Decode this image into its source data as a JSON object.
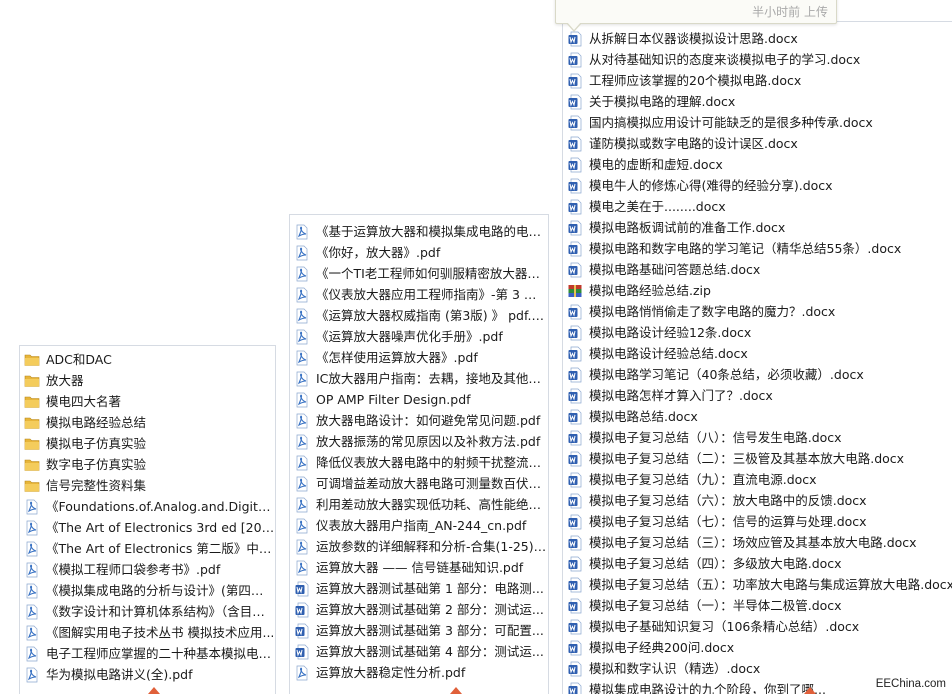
{
  "tooltip": {
    "text": "半小时前 上传"
  },
  "watermark": {
    "text": "EEChina.com"
  },
  "colors": {
    "folder": "#e7b53a",
    "pdf": "#3a73c4",
    "docx": "#2f5fb0",
    "zip": "#c0392b",
    "marker": "#e0603a"
  },
  "panel1": {
    "items": [
      {
        "icon": "folder-icon",
        "label": "ADC和DAC"
      },
      {
        "icon": "folder-icon",
        "label": "放大器"
      },
      {
        "icon": "folder-icon",
        "label": "模电四大名著"
      },
      {
        "icon": "folder-icon",
        "label": "模拟电路经验总结"
      },
      {
        "icon": "folder-icon",
        "label": "模拟电子仿真实验"
      },
      {
        "icon": "folder-icon",
        "label": "数字电子仿真实验"
      },
      {
        "icon": "folder-icon",
        "label": "信号完整性资料集"
      },
      {
        "icon": "pdf-icon",
        "label": "《Foundations.of.Analog.and.Digital.E..."
      },
      {
        "icon": "pdf-icon",
        "label": "《The Art of Electronics 3rd ed [2015..."
      },
      {
        "icon": "pdf-icon",
        "label": "《The Art of Electronics 第二版》中文..."
      },
      {
        "icon": "pdf-icon",
        "label": "《模拟工程师口袋参考书》.pdf"
      },
      {
        "icon": "pdf-icon",
        "label": "《模拟集成电路的分析与设计》(第四版..."
      },
      {
        "icon": "pdf-icon",
        "label": "《数字设计和计算机体系结构》（含目录..."
      },
      {
        "icon": "pdf-icon",
        "label": "《图解实用电子技术丛书 模拟技术应用..."
      },
      {
        "icon": "pdf-icon",
        "label": "电子工程师应掌握的二十种基本模拟电路..."
      },
      {
        "icon": "pdf-icon",
        "label": "华为模拟电路讲义(全).pdf"
      }
    ]
  },
  "panel2": {
    "items": [
      {
        "icon": "pdf-icon",
        "label": "《基于运算放大器和模拟集成电路的电路..."
      },
      {
        "icon": "pdf-icon",
        "label": "《你好，放大器》.pdf"
      },
      {
        "icon": "pdf-icon",
        "label": "《一个TI老工程师如何驯服精密放大器》..."
      },
      {
        "icon": "pdf-icon",
        "label": "《仪表放大器应用工程师指南》-第 3 版..."
      },
      {
        "icon": "pdf-icon",
        "label": "《运算放大器权威指南 (第3版) 》 pdf.pdf"
      },
      {
        "icon": "pdf-icon",
        "label": "《运算放大器噪声优化手册》.pdf"
      },
      {
        "icon": "pdf-icon",
        "label": "《怎样使用运算放大器》.pdf"
      },
      {
        "icon": "pdf-icon",
        "label": "IC放大器用户指南：去耦，接地及其他一..."
      },
      {
        "icon": "pdf-icon",
        "label": "OP AMP Filter Design.pdf"
      },
      {
        "icon": "pdf-icon",
        "label": "放大器电路设计：如何避免常见问题.pdf"
      },
      {
        "icon": "pdf-icon",
        "label": "放大器振荡的常见原因以及补救方法.pdf"
      },
      {
        "icon": "pdf-icon",
        "label": "降低仪表放大器电路中的射频干扰整流误..."
      },
      {
        "icon": "pdf-icon",
        "label": "可调增益差动放大器电路可测量数百伏电..."
      },
      {
        "icon": "pdf-icon",
        "label": "利用差动放大器实现低功耗、高性能绝对..."
      },
      {
        "icon": "pdf-icon",
        "label": "仪表放大器用户指南_AN-244_cn.pdf"
      },
      {
        "icon": "pdf-icon",
        "label": "运放参数的详细解释和分析-合集(1-25)...."
      },
      {
        "icon": "pdf-icon",
        "label": "运算放大器 —— 信号链基础知识.pdf"
      },
      {
        "icon": "docx-icon",
        "label": "运算放大器测试基础第 1 部分：电路测..."
      },
      {
        "icon": "docx-icon",
        "label": "运算放大器测试基础第 2 部分：测试运..."
      },
      {
        "icon": "docx-icon",
        "label": "运算放大器测试基础第 3 部分：可配置..."
      },
      {
        "icon": "docx-icon",
        "label": "运算放大器测试基础第 4 部分：测试运..."
      },
      {
        "icon": "pdf-icon",
        "label": "运算放大器稳定性分析.pdf"
      }
    ]
  },
  "panel3": {
    "items": [
      {
        "icon": "docx-icon",
        "label": "从拆解日本仪器谈模拟设计思路.docx"
      },
      {
        "icon": "docx-icon",
        "label": "从对待基础知识的态度来谈模拟电子的学习.docx"
      },
      {
        "icon": "docx-icon",
        "label": "工程师应该掌握的20个模拟电路.docx"
      },
      {
        "icon": "docx-icon",
        "label": "关于模拟电路的理解.docx"
      },
      {
        "icon": "docx-icon",
        "label": "国内搞模拟应用设计可能缺乏的是很多种传承.docx"
      },
      {
        "icon": "docx-icon",
        "label": "谨防模拟或数字电路的设计误区.docx"
      },
      {
        "icon": "docx-icon",
        "label": "模电的虚断和虚短.docx"
      },
      {
        "icon": "docx-icon",
        "label": "模电牛人的修炼心得(难得的经验分享).docx"
      },
      {
        "icon": "docx-icon",
        "label": "模电之美在于........docx"
      },
      {
        "icon": "docx-icon",
        "label": "模拟电路板调试前的准备工作.docx"
      },
      {
        "icon": "docx-icon",
        "label": "模拟电路和数字电路的学习笔记（精华总结55条）.docx"
      },
      {
        "icon": "docx-icon",
        "label": "模拟电路基础问答题总结.docx"
      },
      {
        "icon": "zip-icon",
        "label": "模拟电路经验总结.zip"
      },
      {
        "icon": "docx-icon",
        "label": "模拟电路悄悄偷走了数字电路的魔力？.docx"
      },
      {
        "icon": "docx-icon",
        "label": "模拟电路设计经验12条.docx"
      },
      {
        "icon": "docx-icon",
        "label": "模拟电路设计经验总结.docx"
      },
      {
        "icon": "docx-icon",
        "label": "模拟电路学习笔记（40条总结，必须收藏）.docx"
      },
      {
        "icon": "docx-icon",
        "label": "模拟电路怎样才算入门了？.docx"
      },
      {
        "icon": "docx-icon",
        "label": "模拟电路总结.docx"
      },
      {
        "icon": "docx-icon",
        "label": "模拟电子复习总结（八）：信号发生电路.docx"
      },
      {
        "icon": "docx-icon",
        "label": "模拟电子复习总结（二）：三极管及其基本放大电路.docx"
      },
      {
        "icon": "docx-icon",
        "label": "模拟电子复习总结（九）：直流电源.docx"
      },
      {
        "icon": "docx-icon",
        "label": "模拟电子复习总结（六）：放大电路中的反馈.docx"
      },
      {
        "icon": "docx-icon",
        "label": "模拟电子复习总结（七）：信号的运算与处理.docx"
      },
      {
        "icon": "docx-icon",
        "label": "模拟电子复习总结（三）：场效应管及其基本放大电路.docx"
      },
      {
        "icon": "docx-icon",
        "label": "模拟电子复习总结（四）：多级放大电路.docx"
      },
      {
        "icon": "docx-icon",
        "label": "模拟电子复习总结（五）：功率放大电路与集成运算放大电路.docx"
      },
      {
        "icon": "docx-icon",
        "label": "模拟电子复习总结（一）：半导体二极管.docx"
      },
      {
        "icon": "docx-icon",
        "label": "模拟电子基础知识复习（106条精心总结）.docx"
      },
      {
        "icon": "docx-icon",
        "label": "模拟电子经典200问.docx"
      },
      {
        "icon": "docx-icon",
        "label": "模拟和数字认识（精选）.docx"
      },
      {
        "icon": "docx-icon",
        "label": "模拟集成电路设计的九个阶段，你到了哪..."
      }
    ]
  }
}
